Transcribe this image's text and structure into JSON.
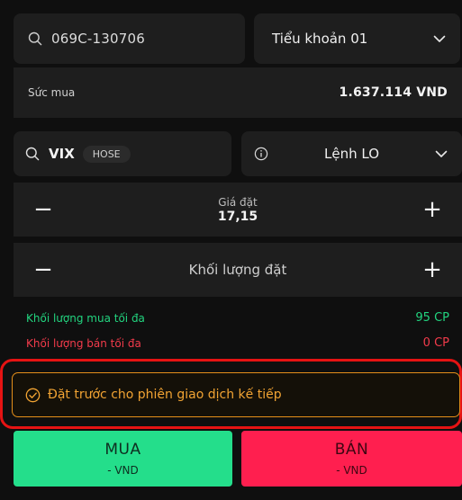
{
  "account": {
    "number": "069C-130706",
    "icon": "search-icon"
  },
  "subaccount": {
    "selected": "Tiểu khoản 01",
    "icon": "chevron-down-icon"
  },
  "buying_power": {
    "label": "Sức mua",
    "value": "1.637.114 VND"
  },
  "symbol": {
    "code": "VIX",
    "exchange": "HOSE",
    "icon": "search-icon"
  },
  "order_type": {
    "selected": "Lệnh LO",
    "info_icon": "info-icon",
    "dropdown_icon": "chevron-down-icon"
  },
  "price": {
    "label": "Giá đặt",
    "value": "17,15",
    "minus": "−",
    "plus": "+"
  },
  "volume": {
    "label": "Khối lượng đặt",
    "minus": "−",
    "plus": "+"
  },
  "max_buy": {
    "label": "Khối lượng mua tối đa",
    "value": "95 CP",
    "color": "#22d47f"
  },
  "max_sell": {
    "label": "Khối lượng bán tối đa",
    "value": "0 CP",
    "color": "#f23b4b"
  },
  "pre_session": {
    "label": "Đặt trước cho phiên giao dịch kế tiếp",
    "icon": "check-circle-icon",
    "color": "#f1a333"
  },
  "buy": {
    "label": "MUA",
    "amount": "- VND",
    "color": "#24de8b"
  },
  "sell": {
    "label": "BÁN",
    "amount": "- VND",
    "color": "#ff1f4f"
  },
  "highlight_color": "#e51313"
}
